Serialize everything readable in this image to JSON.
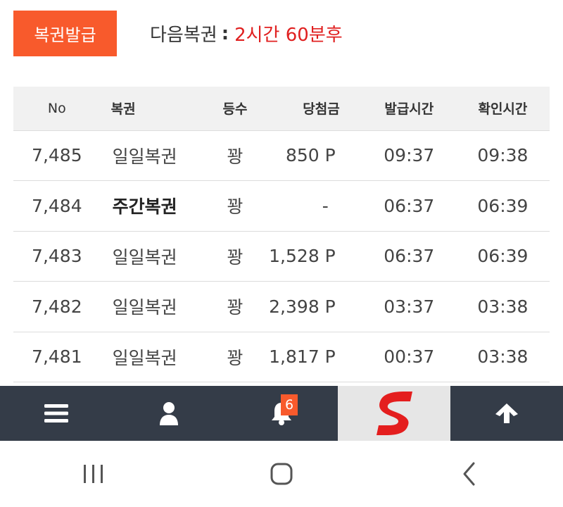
{
  "header": {
    "issue_button_label": "복권발급",
    "next_label": "다음복권",
    "next_colon": ":",
    "next_value": "2시간 60분후"
  },
  "table": {
    "columns": [
      "No",
      "복권",
      "등수",
      "당첨금",
      "발급시간",
      "확인시간"
    ],
    "rows": [
      {
        "no": "7,485",
        "name": "일일복권",
        "rank": "꽝",
        "prize": "850 P",
        "issued": "09:37",
        "checked": "09:38"
      },
      {
        "no": "7,484",
        "name": "주간복권",
        "rank": "꽝",
        "prize": "-",
        "issued": "06:37",
        "checked": "06:39"
      },
      {
        "no": "7,483",
        "name": "일일복권",
        "rank": "꽝",
        "prize": "1,528 P",
        "issued": "06:37",
        "checked": "06:39"
      },
      {
        "no": "7,482",
        "name": "일일복권",
        "rank": "꽝",
        "prize": "2,398 P",
        "issued": "03:37",
        "checked": "03:38"
      },
      {
        "no": "7,481",
        "name": "일일복권",
        "rank": "꽝",
        "prize": "1,817 P",
        "issued": "00:37",
        "checked": "03:38"
      }
    ]
  },
  "bottom_nav": {
    "items": [
      "menu-icon",
      "user-icon",
      "bell-icon",
      "site-logo",
      "arrow-up-icon"
    ],
    "notification_count": "6"
  },
  "colors": {
    "accent": "#f85a2c",
    "next_value": "#e02020",
    "nav_bg": "#343c48"
  }
}
